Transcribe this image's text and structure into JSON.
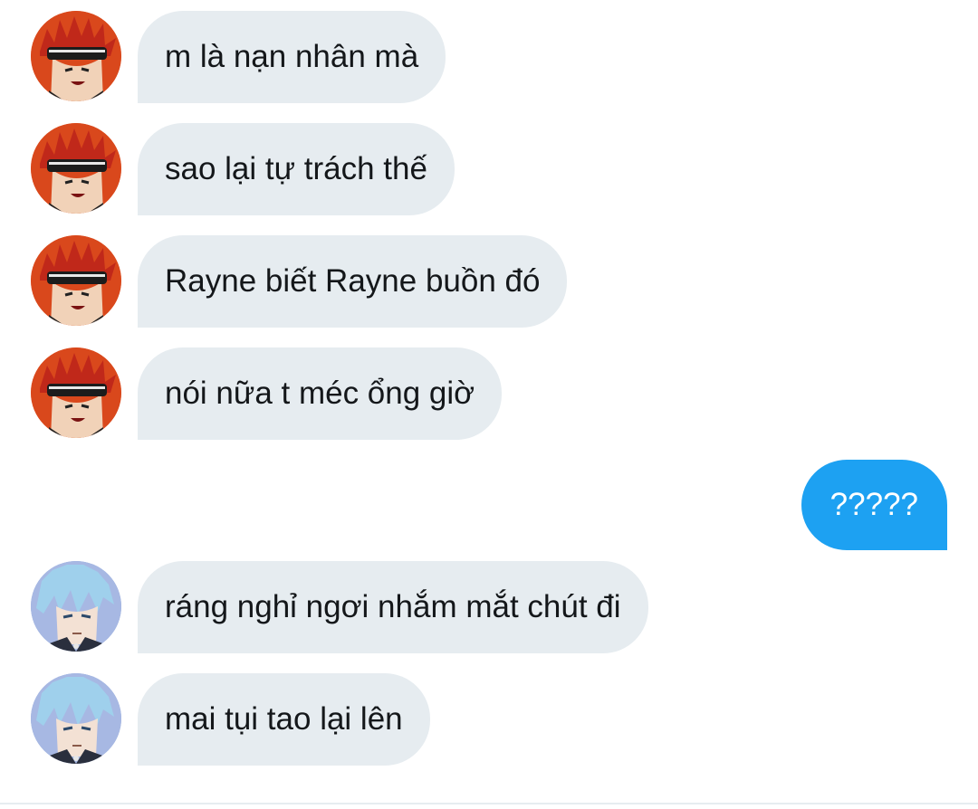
{
  "colors": {
    "incoming_bubble": "#e6ecf0",
    "outgoing_bubble": "#1da1f2",
    "text_dark": "#14171a",
    "text_light": "#ffffff"
  },
  "messages": [
    {
      "direction": "incoming",
      "sender_avatar": "red-hair-avatar-icon",
      "text": "m là nạn nhân mà"
    },
    {
      "direction": "incoming",
      "sender_avatar": "red-hair-avatar-icon",
      "text": "sao lại tự trách thế"
    },
    {
      "direction": "incoming",
      "sender_avatar": "red-hair-avatar-icon",
      "text": "Rayne biết Rayne buồn đó"
    },
    {
      "direction": "incoming",
      "sender_avatar": "red-hair-avatar-icon",
      "text": "nói nữa t méc ổng giờ"
    },
    {
      "direction": "outgoing",
      "text": "?????"
    },
    {
      "direction": "incoming",
      "sender_avatar": "blue-hair-avatar-icon",
      "text": "ráng nghỉ ngơi nhắm mắt chút đi"
    },
    {
      "direction": "incoming",
      "sender_avatar": "blue-hair-avatar-icon",
      "text": "mai tụi tao lại lên"
    }
  ]
}
